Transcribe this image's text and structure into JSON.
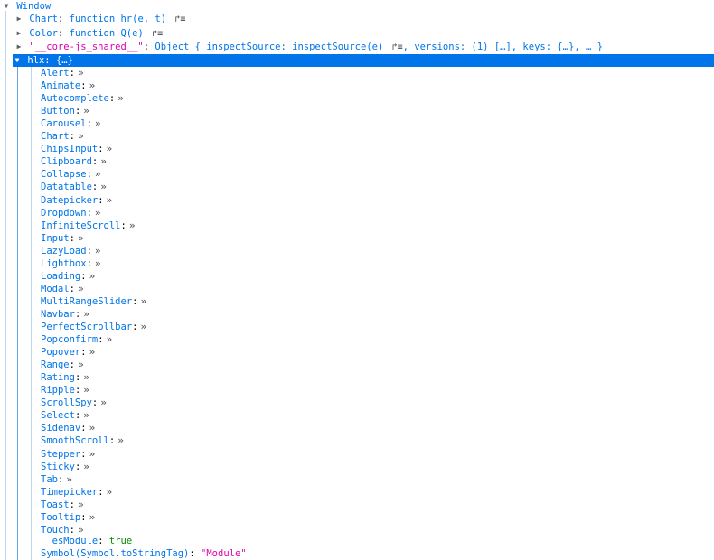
{
  "root": {
    "label": "Window"
  },
  "collapsed_rows": [
    {
      "key": "Chart",
      "sep": ": ",
      "value": "function hr(e, t)",
      "jump": "↱≡"
    },
    {
      "key": "Color",
      "sep": ": ",
      "value": "function Q(e)",
      "jump": "↱≡"
    },
    {
      "key": "\"__core-js_shared__\"",
      "sep": ": ",
      "value": "Object { inspectSource: inspectSource(e)",
      "jump": "↱≡",
      "tail": ", versions: (1) […], keys: {…}, … }"
    }
  ],
  "selected": {
    "key": "hlx",
    "sep": ": ",
    "value": "{…}"
  },
  "children": [
    "Alert",
    "Animate",
    "Autocomplete",
    "Button",
    "Carousel",
    "Chart",
    "ChipsInput",
    "Clipboard",
    "Collapse",
    "Datatable",
    "Datepicker",
    "Dropdown",
    "InfiniteScroll",
    "Input",
    "LazyLoad",
    "Lightbox",
    "Loading",
    "Modal",
    "MultiRangeSlider",
    "Navbar",
    "PerfectScrollbar",
    "Popconfirm",
    "Popover",
    "Range",
    "Rating",
    "Ripple",
    "ScrollSpy",
    "Select",
    "Sidenav",
    "SmoothScroll",
    "Stepper",
    "Sticky",
    "Tab",
    "Timepicker",
    "Toast",
    "Tooltip",
    "Touch"
  ],
  "child_getter_glyph": "»",
  "es_module": {
    "key": "__esModule",
    "sep": ": ",
    "value": "true"
  },
  "symbol_tag": {
    "key": "Symbol(Symbol.toStringTag)",
    "sep": ": ",
    "value": "\"Module\""
  },
  "glyphs": {
    "expanded": "▼",
    "collapsed": "▶"
  }
}
